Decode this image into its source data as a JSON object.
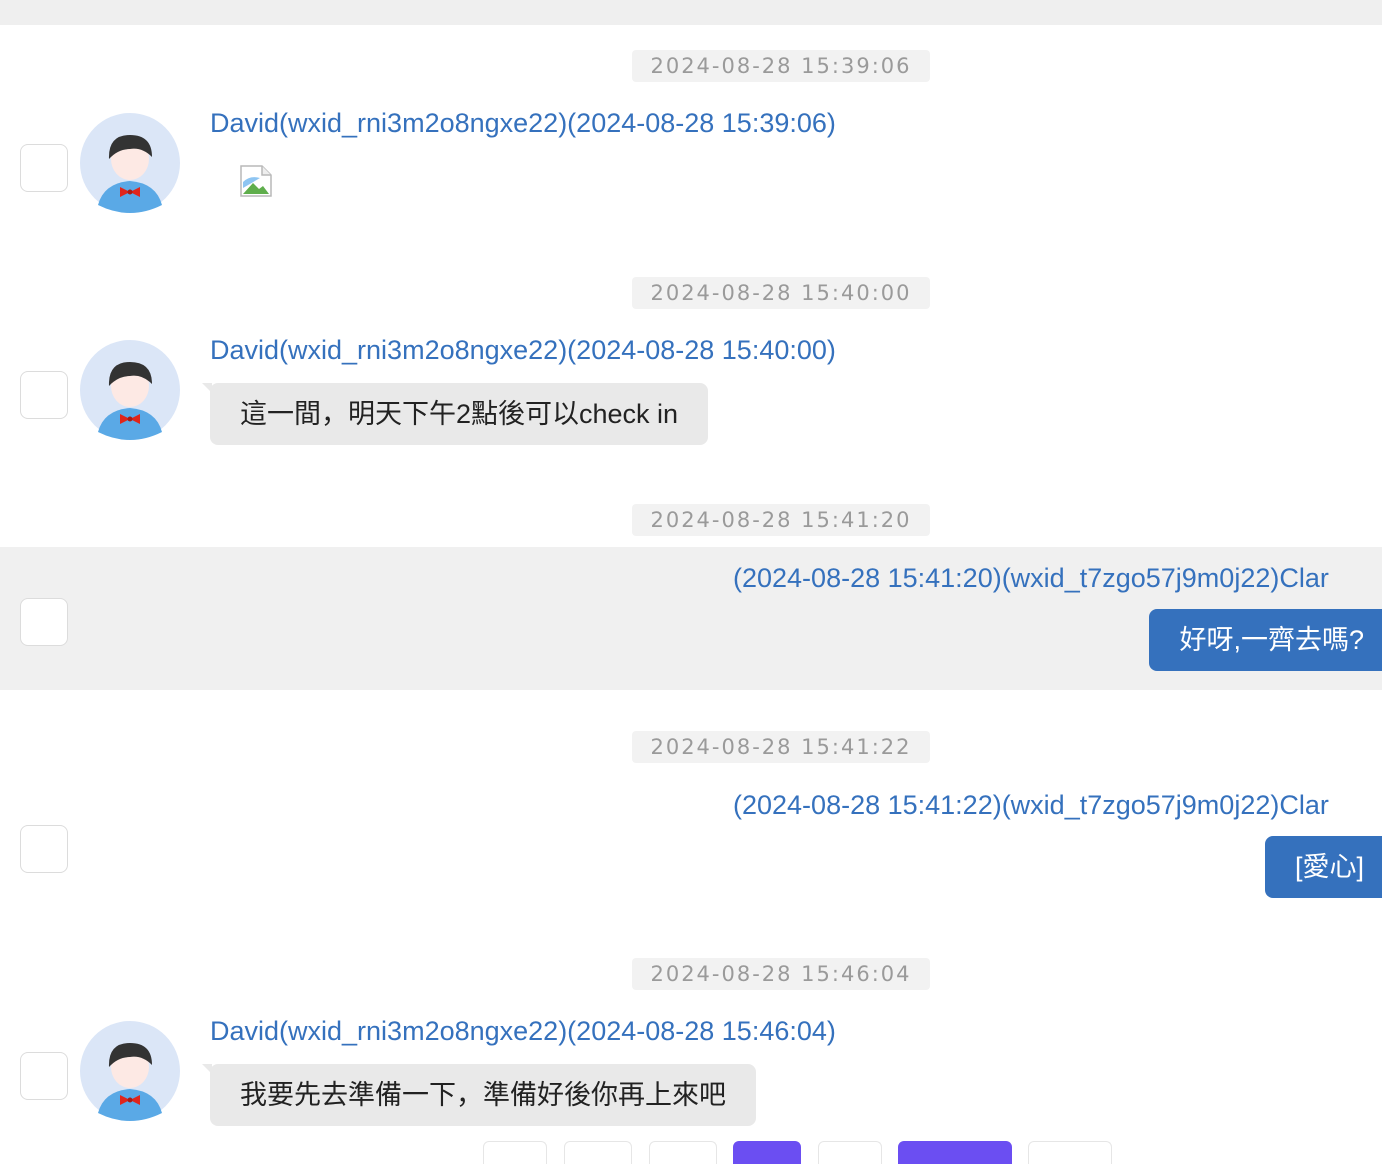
{
  "messages": [
    {
      "time": "2024-08-28 15:39:06",
      "sender": "David(wxid_rni3m2o8ngxe22)(2024-08-28 15:39:06)",
      "type": "image"
    },
    {
      "time": "2024-08-28 15:40:00",
      "sender": "David(wxid_rni3m2o8ngxe22)(2024-08-28 15:40:00)",
      "text": "這一間，明天下午2點後可以check in"
    },
    {
      "time": "2024-08-28 15:41:20",
      "sender": "(2024-08-28 15:41:20)(wxid_t7zgo57j9m0j22)Clar",
      "text": "好呀,一齊去嗎?"
    },
    {
      "time": "2024-08-28 15:41:22",
      "sender": "(2024-08-28 15:41:22)(wxid_t7zgo57j9m0j22)Clar",
      "text": "[愛心]"
    },
    {
      "time": "2024-08-28 15:46:04",
      "sender": "David(wxid_rni3m2o8ngxe22)(2024-08-28 15:46:04)",
      "text": "我要先去準備一下，準備好後你再上來吧"
    }
  ],
  "colors": {
    "link": "#3571bd",
    "bubble_self": "#3571bd",
    "bubble_other": "#e9e9e9",
    "highlight": "#f0f0f0",
    "pager_active": "#6b4ef2"
  },
  "icons": {
    "avatar": "boy-avatar-icon",
    "broken_image": "broken-image-icon"
  }
}
